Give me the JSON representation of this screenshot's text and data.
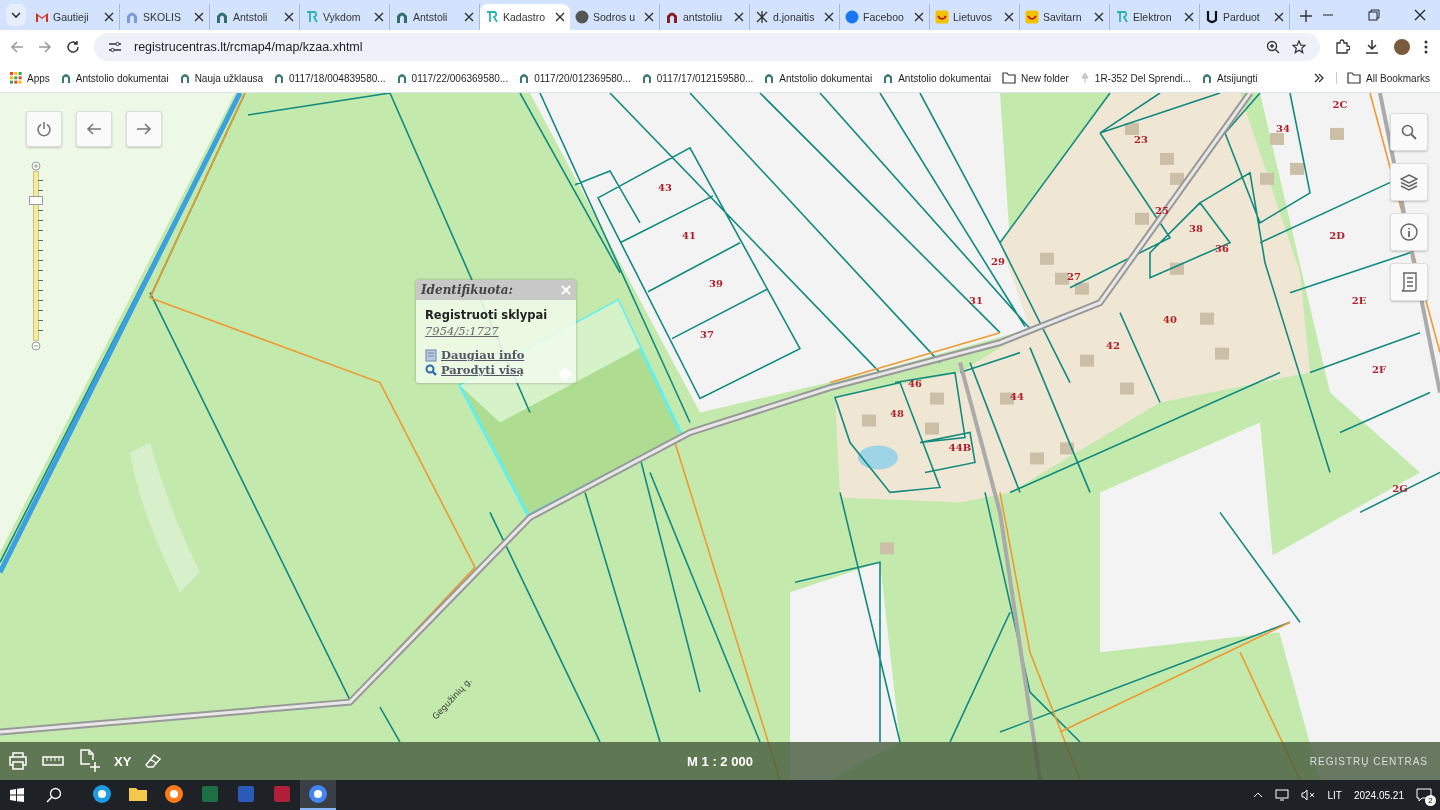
{
  "browser": {
    "tabs": [
      {
        "title": "Gautieji",
        "kind": "mail",
        "selected": false
      },
      {
        "title": "SKOLIS",
        "kind": "flask",
        "selected": false
      },
      {
        "title": "Antstoli",
        "kind": "arch",
        "selected": false
      },
      {
        "title": "Vykdom",
        "kind": "rc",
        "selected": false
      },
      {
        "title": "Antstoli",
        "kind": "arch",
        "selected": false
      },
      {
        "title": "Kadastro",
        "kind": "rc",
        "selected": true
      },
      {
        "title": "Sodros u",
        "kind": "globe",
        "selected": false
      },
      {
        "title": "antstoliu",
        "kind": "dome",
        "selected": false
      },
      {
        "title": "d.jonaitis",
        "kind": "cross",
        "selected": false
      },
      {
        "title": "Faceboo",
        "kind": "fb",
        "selected": false
      },
      {
        "title": "Lietuvos",
        "kind": "shell",
        "selected": false
      },
      {
        "title": "Savitarn",
        "kind": "shell",
        "selected": false
      },
      {
        "title": "Elektron",
        "kind": "rc",
        "selected": false
      },
      {
        "title": "Parduot",
        "kind": "u",
        "selected": false
      }
    ],
    "address": "registrucentras.lt/rcmap4/map/kzaa.xhtml",
    "bookmarks": [
      {
        "label": "Apps",
        "kind": "apps"
      },
      {
        "label": "Antstolio dokumentai",
        "kind": "arch"
      },
      {
        "label": "Nauja užklausa",
        "kind": "arch"
      },
      {
        "label": "0117/18/004839580...",
        "kind": "arch"
      },
      {
        "label": "0117/22/006369580...",
        "kind": "arch"
      },
      {
        "label": "0117/20/012369580...",
        "kind": "arch"
      },
      {
        "label": "0117/17/012159580...",
        "kind": "arch"
      },
      {
        "label": "Antstolio dokumentai",
        "kind": "arch"
      },
      {
        "label": "Antstolio dokumentai",
        "kind": "arch"
      },
      {
        "label": "New folder",
        "kind": "folder"
      },
      {
        "label": "1R-352 Del Sprendi...",
        "kind": "pin"
      },
      {
        "label": "Atsijungti",
        "kind": "arch"
      }
    ],
    "all_bookmarks": "All Bookmarks"
  },
  "map": {
    "zoom": {
      "level": 0.85
    },
    "popup": {
      "title": "Identifikuota:",
      "layer": "Registruoti sklypai",
      "parcel_id": "7954/5:1727",
      "links": [
        {
          "label": "Daugiau info",
          "kind": "info"
        },
        {
          "label": "Parodyti visą",
          "kind": "zoom"
        }
      ]
    },
    "parcel_labels": [
      "43",
      "41",
      "39",
      "37",
      "29",
      "31",
      "23",
      "25",
      "27",
      "34",
      "38",
      "36",
      "40",
      "42",
      "44",
      "46",
      "48",
      "44B",
      "2C",
      "2D",
      "2E",
      "2F",
      "2G"
    ],
    "road_label": "Gegužinių g.",
    "tools": {
      "xy": "XY"
    },
    "scale": "M 1 : 2 000",
    "logo": "REGISTRŲ CENTRAS"
  },
  "taskbar": {
    "apps": [
      {
        "kind": "edge",
        "selected": false
      },
      {
        "kind": "explorer",
        "selected": false
      },
      {
        "kind": "firefox",
        "selected": false
      },
      {
        "kind": "excel",
        "selected": false
      },
      {
        "kind": "word",
        "selected": false
      },
      {
        "kind": "app",
        "selected": false
      },
      {
        "kind": "chrome",
        "selected": true
      }
    ],
    "language": "LIT",
    "date": "2024.05.21",
    "notifications": "2"
  }
}
